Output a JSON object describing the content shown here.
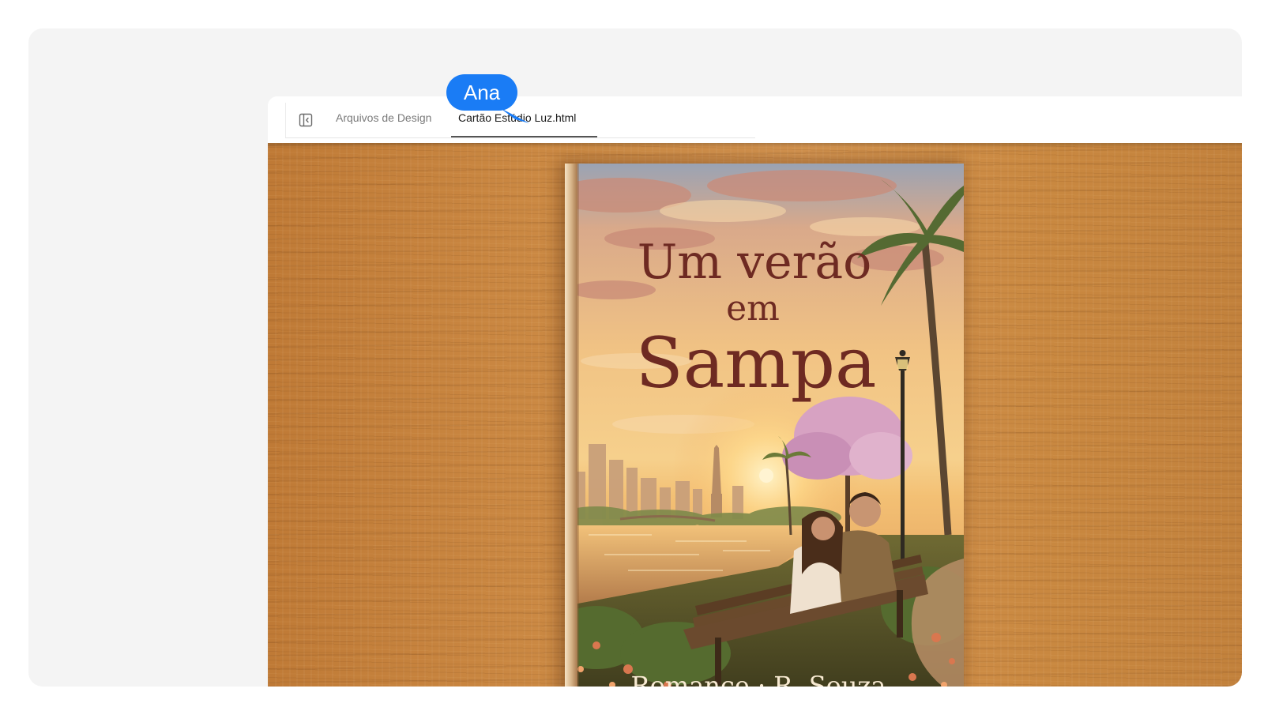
{
  "tabs": {
    "files_label": "Arquivos de Design",
    "active_label": "Cartão Estúdio Luz.html"
  },
  "collaborator": {
    "name": "Ana",
    "color": "#1a7cf5"
  },
  "book": {
    "title_line1": "Um verão",
    "title_line2": "em",
    "title_line3": "Sampa",
    "footer": "Romance · R. Souza",
    "title_color": "#6e2a22"
  },
  "icons": {
    "sidebar_toggle": "sidebar-toggle-icon"
  }
}
